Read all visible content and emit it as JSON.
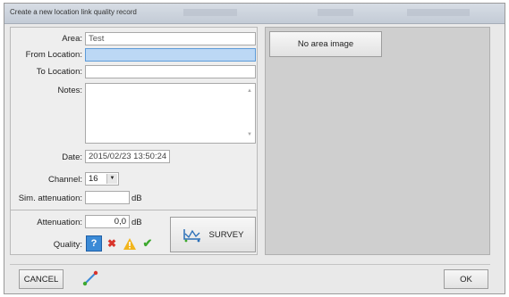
{
  "window": {
    "title": "Create a new location link quality record"
  },
  "form": {
    "area": {
      "label": "Area:",
      "value": "Test"
    },
    "from_location": {
      "label": "From Location:",
      "value": ""
    },
    "to_location": {
      "label": "To Location:",
      "value": ""
    },
    "notes": {
      "label": "Notes:",
      "value": ""
    },
    "date": {
      "label": "Date:",
      "value": "2015/02/23 13:50:24"
    },
    "channel": {
      "label": "Channel:",
      "value": "16"
    },
    "sim_attenuation": {
      "label": "Sim. attenuation:",
      "value": "",
      "unit": "dB"
    },
    "attenuation": {
      "label": "Attenuation:",
      "value": "0,0",
      "unit": "dB"
    },
    "quality": {
      "label": "Quality:",
      "options": [
        "question-icon",
        "cross-icon",
        "warning-icon",
        "check-icon"
      ],
      "selected": "question-icon"
    }
  },
  "survey_button": {
    "label": "SURVEY"
  },
  "area_image": {
    "placeholder_label": "No area image"
  },
  "buttons": {
    "cancel": "CANCEL",
    "ok": "OK"
  },
  "colors": {
    "focus_field": "#bcd8f5",
    "selected_quality": "#3b8ad6",
    "cross": "#d9342b",
    "warning": "#f2b51c",
    "check": "#3da82e"
  }
}
